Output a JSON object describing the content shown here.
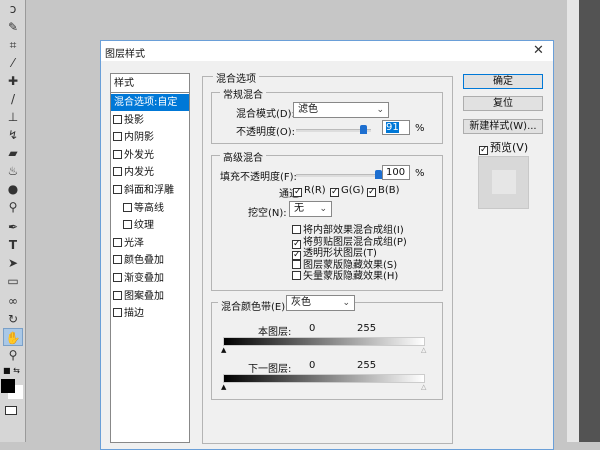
{
  "dialog": {
    "title": "图层样式",
    "close": "✕"
  },
  "styles": {
    "header": "样式",
    "items": [
      {
        "label": "混合选项:自定",
        "checkbox": false,
        "selected": true
      },
      {
        "label": "投影",
        "checkbox": true,
        "checked": false
      },
      {
        "label": "内阴影",
        "checkbox": true,
        "checked": false
      },
      {
        "label": "外发光",
        "checkbox": true,
        "checked": false
      },
      {
        "label": "内发光",
        "checkbox": true,
        "checked": false
      },
      {
        "label": "斜面和浮雕",
        "checkbox": true,
        "checked": false
      },
      {
        "label": "等高线",
        "checkbox": true,
        "checked": false,
        "indent": true
      },
      {
        "label": "纹理",
        "checkbox": true,
        "checked": false,
        "indent": true
      },
      {
        "label": "光泽",
        "checkbox": true,
        "checked": false
      },
      {
        "label": "颜色叠加",
        "checkbox": true,
        "checked": false
      },
      {
        "label": "渐变叠加",
        "checkbox": true,
        "checked": false
      },
      {
        "label": "图案叠加",
        "checkbox": true,
        "checked": false
      },
      {
        "label": "描边",
        "checkbox": true,
        "checked": false
      }
    ]
  },
  "blend": {
    "title": "混合选项",
    "general": {
      "title": "常规混合",
      "mode_label": "混合模式(D):",
      "mode_value": "滤色",
      "opacity_label": "不透明度(O):",
      "opacity_value": "91",
      "opacity_unit": "%",
      "opacity_fraction": 0.91
    },
    "advanced": {
      "title": "高级混合",
      "fill_label": "填充不透明度(F):",
      "fill_value": "100",
      "fill_unit": "%",
      "fill_fraction": 1.0,
      "channels_label": "通道:",
      "channels": [
        {
          "label": "R(R)",
          "checked": true
        },
        {
          "label": "G(G)",
          "checked": true
        },
        {
          "label": "B(B)",
          "checked": true
        }
      ],
      "knockout_label": "挖空(N):",
      "knockout_value": "无",
      "options": [
        {
          "label": "将内部效果混合成组(I)",
          "checked": false
        },
        {
          "label": "将剪贴图层混合成组(P)",
          "checked": true
        },
        {
          "label": "透明形状图层(T)",
          "checked": true
        },
        {
          "label": "图层蒙版隐藏效果(S)",
          "checked": false
        },
        {
          "label": "矢量蒙版隐藏效果(H)",
          "checked": false
        }
      ]
    },
    "blend_if": {
      "label": "混合颜色带(E):",
      "value": "灰色",
      "this_layer": {
        "label": "本图层:",
        "low": "0",
        "high": "255"
      },
      "underlying": {
        "label": "下一图层:",
        "low": "0",
        "high": "255"
      }
    }
  },
  "buttons": {
    "ok": "确定",
    "reset": "复位",
    "new_style": "新建样式(W)...",
    "preview": "预览(V)",
    "preview_checked": true
  },
  "tools": [
    "lasso",
    "quick-select",
    "crop",
    "eyedropper",
    "healing",
    "brush",
    "stamp",
    "history-brush",
    "eraser",
    "paint-bucket",
    "blur",
    "dodge",
    "pen",
    "type",
    "path-select",
    "rectangle",
    "3d-rotate",
    "3d-orbit",
    "hand",
    "zoom"
  ]
}
